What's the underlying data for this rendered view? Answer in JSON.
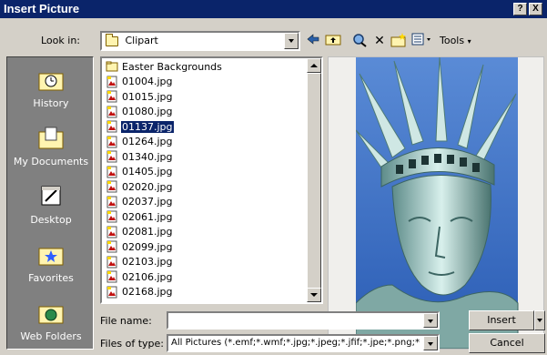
{
  "window": {
    "title": "Insert Picture",
    "help_button": "?",
    "close_button": "X"
  },
  "lookin": {
    "label": "Look in:",
    "value": "Clipart"
  },
  "toolbar": {
    "tools_label": "Tools",
    "icons": [
      "back-icon",
      "up-folder-icon",
      "search-web-icon",
      "delete-icon",
      "new-folder-icon",
      "views-icon"
    ]
  },
  "places": [
    {
      "label": "History",
      "icon": "history-icon"
    },
    {
      "label": "My Documents",
      "icon": "my-documents-icon"
    },
    {
      "label": "Desktop",
      "icon": "desktop-icon"
    },
    {
      "label": "Favorites",
      "icon": "favorites-icon"
    },
    {
      "label": "Web Folders",
      "icon": "web-folders-icon"
    }
  ],
  "files": [
    {
      "name": "Easter Backgrounds",
      "type": "folder"
    },
    {
      "name": "01004.jpg",
      "type": "jpg"
    },
    {
      "name": "01015.jpg",
      "type": "jpg"
    },
    {
      "name": "01080.jpg",
      "type": "jpg"
    },
    {
      "name": "01137.jpg",
      "type": "jpg",
      "selected": true
    },
    {
      "name": "01264.jpg",
      "type": "jpg"
    },
    {
      "name": "01340.jpg",
      "type": "jpg"
    },
    {
      "name": "01405.jpg",
      "type": "jpg"
    },
    {
      "name": "02020.jpg",
      "type": "jpg"
    },
    {
      "name": "02037.jpg",
      "type": "jpg"
    },
    {
      "name": "02061.jpg",
      "type": "jpg"
    },
    {
      "name": "02081.jpg",
      "type": "jpg"
    },
    {
      "name": "02099.jpg",
      "type": "jpg"
    },
    {
      "name": "02103.jpg",
      "type": "jpg"
    },
    {
      "name": "02106.jpg",
      "type": "jpg"
    },
    {
      "name": "02168.jpg",
      "type": "jpg"
    }
  ],
  "filename": {
    "label": "File name:",
    "value": ""
  },
  "filetype": {
    "label": "Files of type:",
    "value": "All Pictures (*.emf;*.wmf;*.jpg;*.jpeg;*.jfif;*.jpe;*.png;*"
  },
  "buttons": {
    "insert": "Insert",
    "cancel": "Cancel"
  },
  "colors": {
    "titlebar": "#0a246a",
    "dialog": "#d4d0c8",
    "places_bg": "#808080",
    "selection": "#0a246a",
    "preview_sky": "#3a6fc4"
  }
}
